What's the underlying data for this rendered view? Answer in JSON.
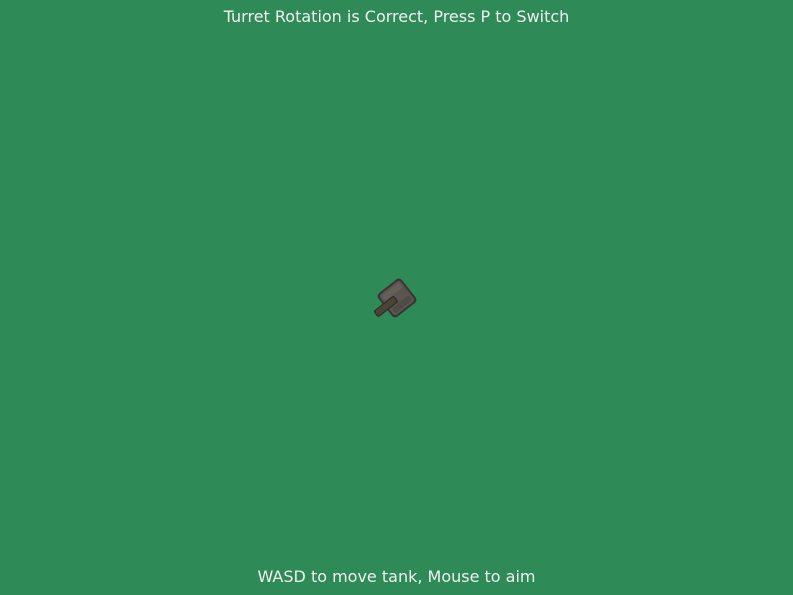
{
  "hud": {
    "status_message": "Turret Rotation is Correct, Press P to Switch",
    "controls_hint": "WASD to move tank, Mouse to aim"
  },
  "scene": {
    "background_color": "#2e8b57",
    "tank": {
      "hull_color": "#5a5550",
      "hull_edge_color": "#3b3631",
      "barrel_color": "#4a4436",
      "barrel_edge_color": "#2f2a20"
    }
  }
}
